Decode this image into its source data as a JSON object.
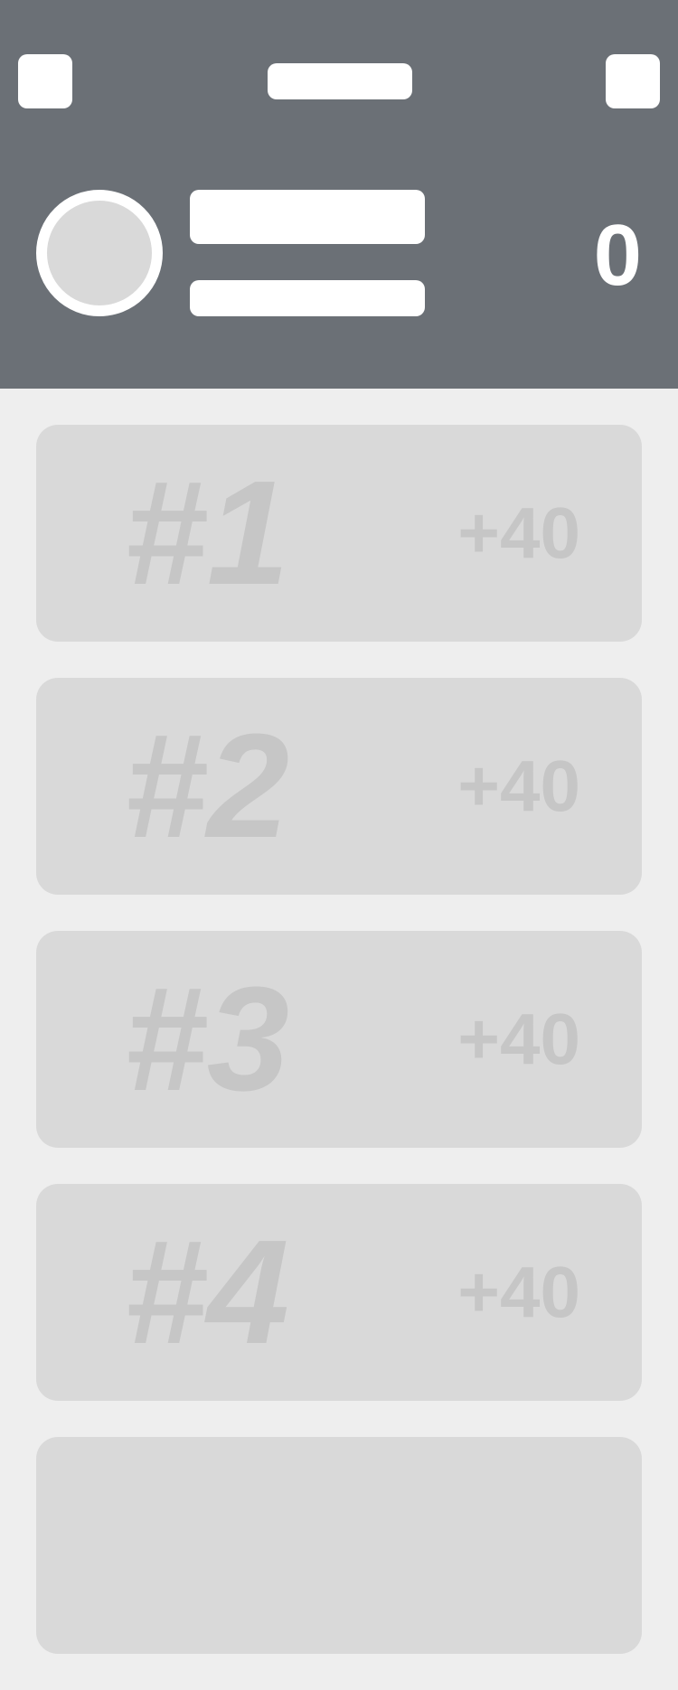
{
  "header": {
    "score": "0"
  },
  "cards": [
    {
      "rank": "#1",
      "points": "+40"
    },
    {
      "rank": "#2",
      "points": "+40"
    },
    {
      "rank": "#3",
      "points": "+40"
    },
    {
      "rank": "#4",
      "points": "+40"
    },
    {
      "rank": "",
      "points": ""
    }
  ],
  "colors": {
    "header_bg": "#6b7076",
    "page_bg": "#eeeeee",
    "card_bg": "#d9d9d9",
    "card_text": "#c6c6c6",
    "placeholder": "#ffffff"
  }
}
